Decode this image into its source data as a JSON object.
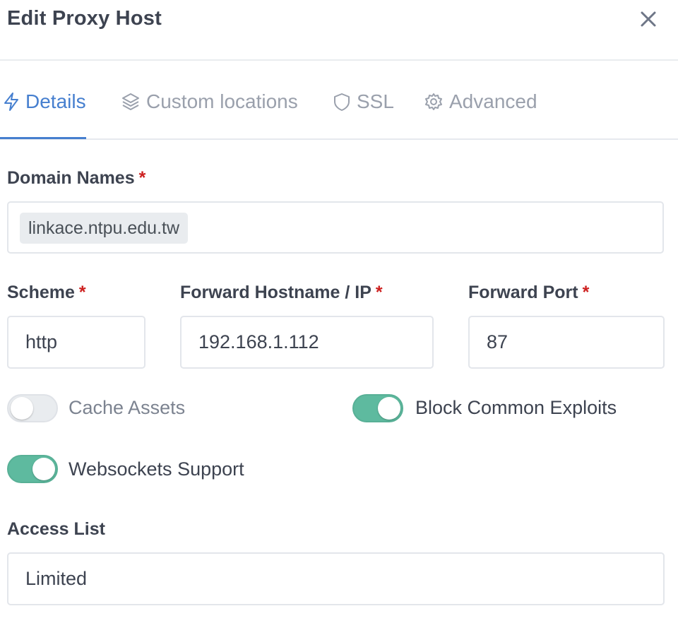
{
  "modal": {
    "title": "Edit Proxy Host",
    "close_icon": "close-icon"
  },
  "tabs": [
    {
      "label": "Details",
      "icon": "lightning-icon",
      "active": true
    },
    {
      "label": "Custom locations",
      "icon": "layers-icon",
      "active": false
    },
    {
      "label": "SSL",
      "icon": "shield-icon",
      "active": false
    },
    {
      "label": "Advanced",
      "icon": "gear-icon",
      "active": false
    }
  ],
  "form": {
    "domain_names": {
      "label": "Domain Names",
      "required_mark": "*",
      "tags": [
        "linkace.ntpu.edu.tw"
      ]
    },
    "scheme": {
      "label": "Scheme",
      "required_mark": "*",
      "value": "http"
    },
    "forward_host": {
      "label": "Forward Hostname / IP",
      "required_mark": "*",
      "value": "192.168.1.112"
    },
    "forward_port": {
      "label": "Forward Port",
      "required_mark": "*",
      "value": "87"
    },
    "toggles": {
      "cache_assets": {
        "label": "Cache Assets",
        "on": false
      },
      "block_exploits": {
        "label": "Block Common Exploits",
        "on": true
      },
      "websockets": {
        "label": "Websockets Support",
        "on": true
      }
    },
    "access_list": {
      "label": "Access List",
      "value": "Limited"
    }
  },
  "colors": {
    "accent": "#467fcf",
    "toggle_on": "#5eba9f",
    "required": "#cd201f",
    "muted": "#9aa0ac"
  }
}
